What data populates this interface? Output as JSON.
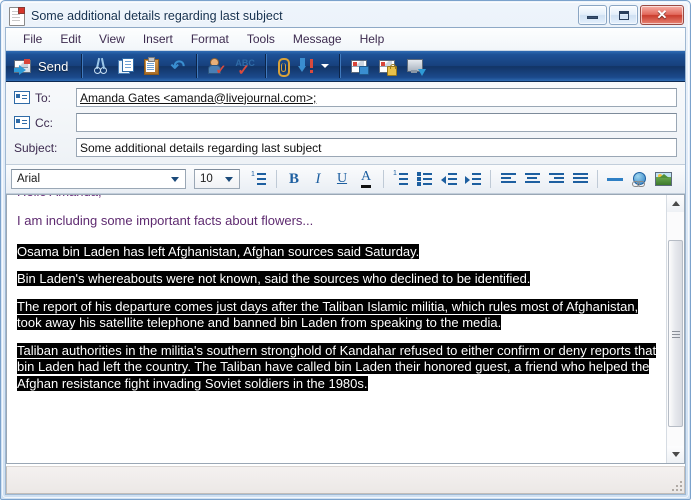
{
  "window": {
    "title": "Some additional details regarding last subject",
    "icon": "document-icon",
    "caption": {
      "minimize": "Minimize",
      "maximize": "Maximize",
      "close": "✕"
    }
  },
  "menubar": {
    "items": [
      {
        "label": "File"
      },
      {
        "label": "Edit"
      },
      {
        "label": "View"
      },
      {
        "label": "Insert"
      },
      {
        "label": "Format"
      },
      {
        "label": "Tools"
      },
      {
        "label": "Message"
      },
      {
        "label": "Help"
      }
    ]
  },
  "toolbar": {
    "send_label": "Send",
    "buttons": [
      {
        "name": "send",
        "icon": "send-mail-icon",
        "label": "Send"
      },
      {
        "name": "cut",
        "icon": "scissors-icon",
        "label": "Cut"
      },
      {
        "name": "copy",
        "icon": "copy-icon",
        "label": "Copy"
      },
      {
        "name": "paste",
        "icon": "paste-clipboard-icon",
        "label": "Paste"
      },
      {
        "name": "undo",
        "icon": "undo-arrow-icon",
        "label": "Undo"
      },
      {
        "name": "check-names",
        "icon": "check-names-icon",
        "label": "Check Names"
      },
      {
        "name": "spelling",
        "icon": "abc-spellcheck-icon",
        "label": "Spelling"
      },
      {
        "name": "attach",
        "icon": "paperclip-icon",
        "label": "Attach"
      },
      {
        "name": "priority",
        "icon": "priority-arrow-icon",
        "label": "Priority"
      },
      {
        "name": "priority-menu",
        "icon": "chevron-down-icon",
        "label": ""
      },
      {
        "name": "sign",
        "icon": "envelope-sign-icon",
        "label": "Sign"
      },
      {
        "name": "encrypt",
        "icon": "envelope-lock-icon",
        "label": "Encrypt"
      },
      {
        "name": "offline",
        "icon": "monitor-offline-icon",
        "label": "Work Offline"
      }
    ]
  },
  "headers": {
    "to": {
      "label": "To:",
      "icon": "address-book-icon",
      "value": "Amanda Gates <amanda@livejournal.com>;",
      "placeholder": ""
    },
    "cc": {
      "label": "Cc:",
      "icon": "address-book-icon",
      "value": "",
      "placeholder": ""
    },
    "subject": {
      "label": "Subject:",
      "value": "Some additional details regarding last subject",
      "placeholder": ""
    }
  },
  "format_toolbar": {
    "font": {
      "value": "Arial",
      "placeholder": "Font"
    },
    "size": {
      "value": "10",
      "placeholder": "Size"
    },
    "buttons": [
      {
        "name": "paragraph-style",
        "icon": "paragraph-style-icon",
        "label": "Paragraph Style"
      },
      {
        "name": "bold",
        "icon": "bold-icon",
        "label": "B"
      },
      {
        "name": "italic",
        "icon": "italic-icon",
        "label": "I"
      },
      {
        "name": "underline",
        "icon": "underline-icon",
        "label": "U"
      },
      {
        "name": "font-color",
        "icon": "font-color-icon",
        "label": "A"
      },
      {
        "name": "numbered-list",
        "icon": "numbered-list-icon",
        "label": "Numbering"
      },
      {
        "name": "bulleted-list",
        "icon": "bulleted-list-icon",
        "label": "Bullets"
      },
      {
        "name": "decrease-indent",
        "icon": "decrease-indent-icon",
        "label": "Decrease Indent"
      },
      {
        "name": "increase-indent",
        "icon": "increase-indent-icon",
        "label": "Increase Indent"
      },
      {
        "name": "align-left",
        "icon": "align-left-icon",
        "label": "Align Left"
      },
      {
        "name": "align-center",
        "icon": "align-center-icon",
        "label": "Center"
      },
      {
        "name": "align-right",
        "icon": "align-right-icon",
        "label": "Align Right"
      },
      {
        "name": "justify",
        "icon": "justify-icon",
        "label": "Justify"
      },
      {
        "name": "horizontal-line",
        "icon": "horizontal-line-icon",
        "label": "Horizontal Line"
      },
      {
        "name": "insert-link",
        "icon": "globe-link-icon",
        "label": "Insert Hyperlink"
      },
      {
        "name": "insert-picture",
        "icon": "picture-icon",
        "label": "Insert Picture"
      }
    ]
  },
  "body": {
    "clipped_top_line": "Hello Amanda,",
    "intro": "I am including some important facts about flowers...",
    "selected_paragraphs": [
      "Osama bin Laden has left Afghanistan, Afghan sources said Saturday.",
      "Bin Laden's whereabouts were not known, said the sources who declined to be identified.",
      "The report of his departure comes just days after the Taliban Islamic militia, which rules most of Afghanistan, took away his satellite telephone and banned bin Laden from speaking to the media.",
      "Taliban authorities in the militia's southern stronghold of Kandahar refused to either confirm or deny reports that bin Laden had left the country. The Taliban have called bin Laden their honored guest, a friend who helped the Afghan resistance fight invading Soviet soldiers in the 1980s."
    ]
  },
  "statusbar": {
    "text": ""
  },
  "colors": {
    "titlebar_accent": "#cfe0f2",
    "toolbar_blue": "#17407c",
    "selection_background": "#000000",
    "selection_text": "#ffffff",
    "body_text": "#3d2b4f",
    "close_button": "#c93b2c"
  }
}
